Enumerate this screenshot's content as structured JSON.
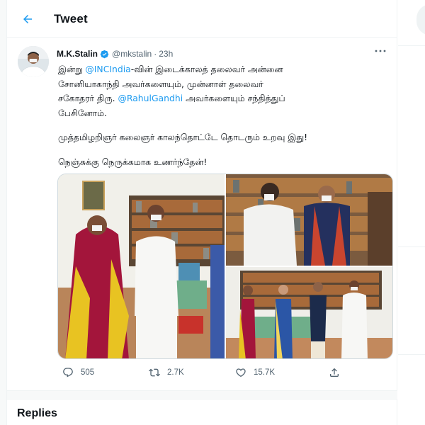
{
  "header": {
    "title": "Tweet",
    "back_icon": "arrow-left-icon"
  },
  "tweet": {
    "author_name": "M.K.Stalin",
    "handle": "@mkstalin",
    "separator": "·",
    "time": "23h",
    "verified": true,
    "line1_a": "இன்று ",
    "mention1": "@INCIndia",
    "line1_b": "-வின் இடைக்காலத் தலைவர் அன்னை",
    "line2": "சோனியாகாந்தி அவர்களையும், முன்னாள் தலைவர்",
    "line3_a": "சகோதரர் திரு. ",
    "mention2": "@RahulGandhi",
    "line3_b": " அவர்களையும் சந்தித்துப்",
    "line4": "பேசினோம்.",
    "para2": "முத்தமிழறிஞர் கலைஞர் காலந்தொட்டே தொடரும் உறவு இது!",
    "para3": "நெஞ்சுக்கு நெருக்கமாக உணர்ந்தேன்!"
  },
  "actions": {
    "replies": "505",
    "retweets": "2.7K",
    "likes": "15.7K"
  },
  "replies_section": {
    "title": "Replies"
  },
  "colors": {
    "accent": "#1d9bf0",
    "text_secondary": "#536471",
    "border": "#eff3f4"
  }
}
